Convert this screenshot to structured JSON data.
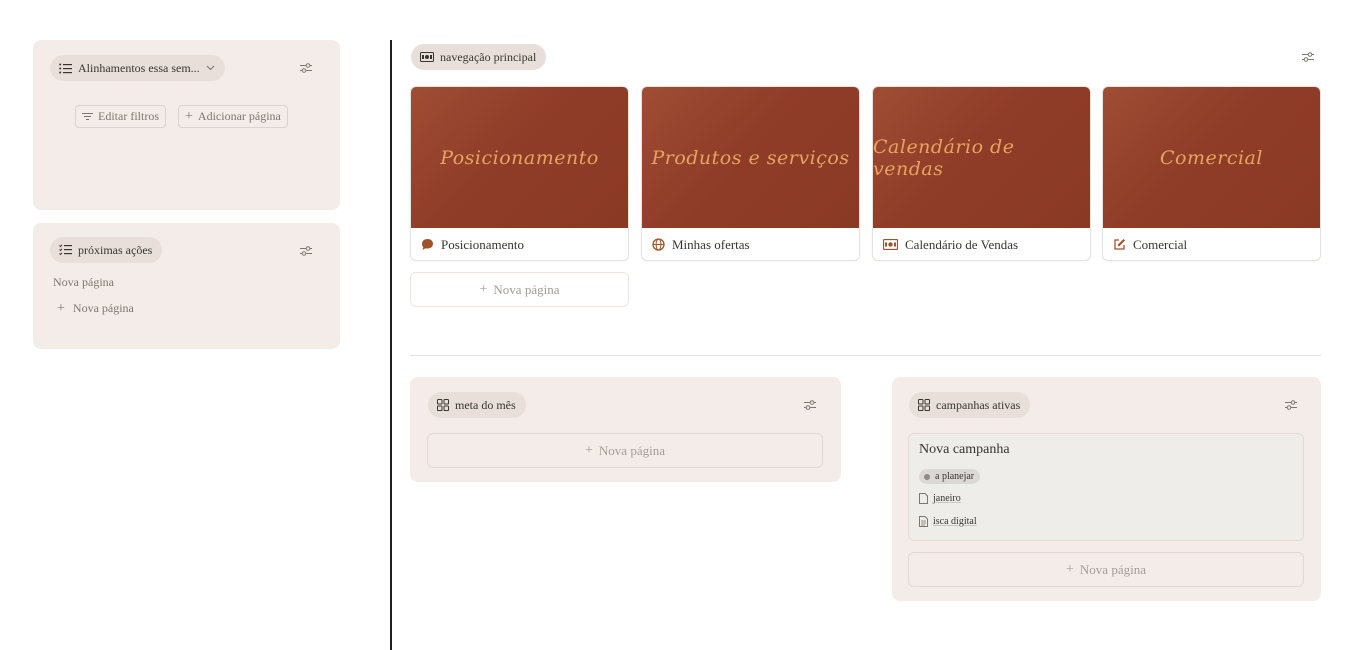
{
  "left": {
    "alignments": {
      "chip_label": "Alinhamentos essa sem...",
      "edit_filters": "Editar filtros",
      "add_page": "Adicionar página"
    },
    "next_actions": {
      "chip_label": "próximas ações",
      "item": "Nova página",
      "new_page": "Nova página"
    }
  },
  "main": {
    "navigation": {
      "chip_label": "navegação principal",
      "cards": [
        {
          "cover_text": "Posicionamento",
          "title": "Posicionamento",
          "icon": "speech-bubble-icon"
        },
        {
          "cover_text": "Produtos e serviços",
          "title": "Minhas ofertas",
          "icon": "globe-icon"
        },
        {
          "cover_text": "Calendário de vendas",
          "title": "Calendário de Vendas",
          "icon": "money-icon"
        },
        {
          "cover_text": "Comercial",
          "title": "Comercial",
          "icon": "edit-icon"
        }
      ],
      "new_page": "Nova página"
    },
    "goal": {
      "chip_label": "meta do mês",
      "new_page": "Nova página"
    },
    "campaigns": {
      "chip_label": "campanhas ativas",
      "card": {
        "title": "Nova campanha",
        "status": "a planejar",
        "month": "janeiro",
        "asset": "isca digital"
      },
      "new_page": "Nova página"
    }
  },
  "colors": {
    "panel_bg": "#f4ece8",
    "cover_bg": "#943f2a",
    "cover_text": "#e6a45e",
    "icon_accent": "#a0522d"
  }
}
